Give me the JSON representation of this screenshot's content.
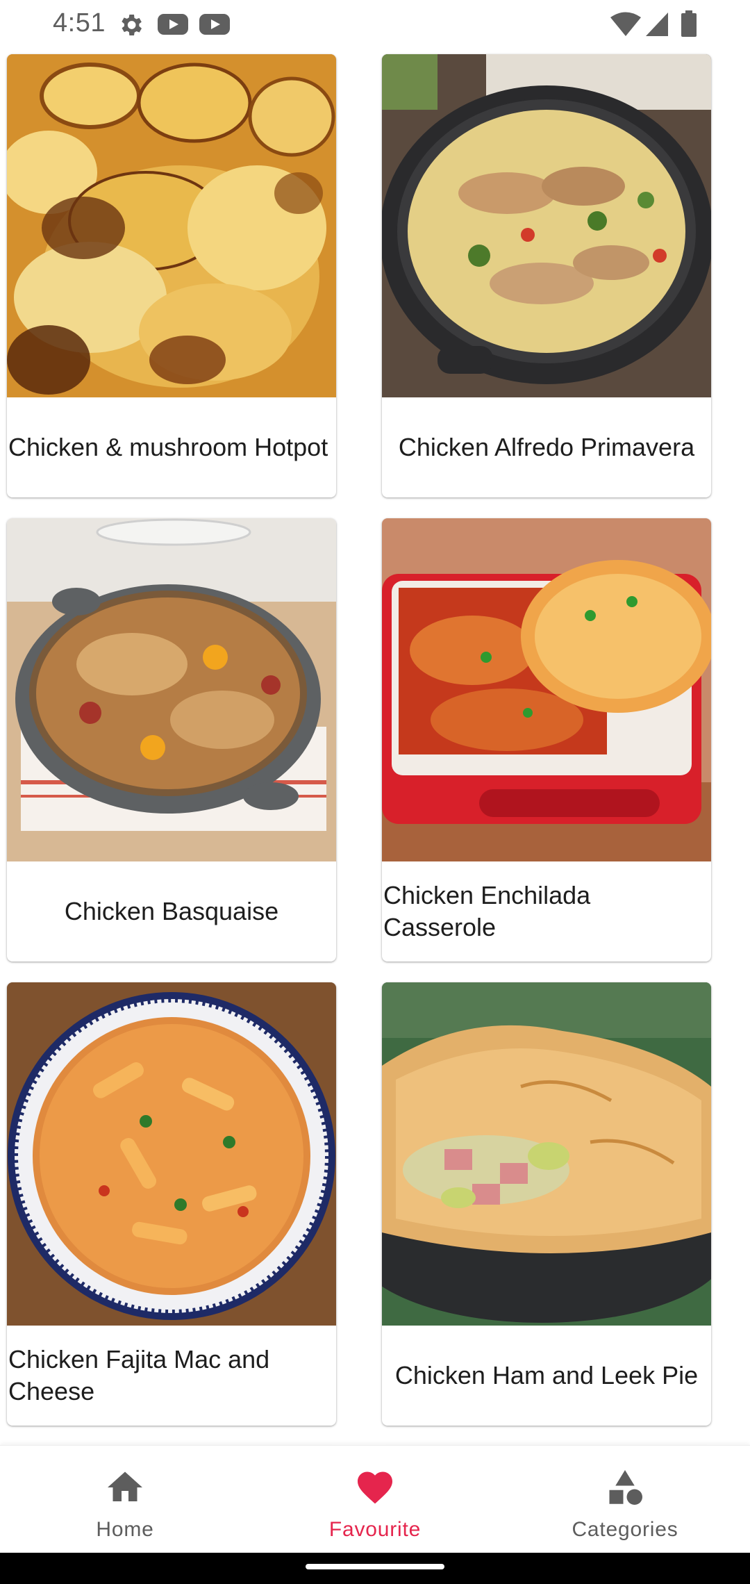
{
  "status_bar": {
    "time": "4:51",
    "icons_left": [
      "gear-icon",
      "youtube-icon",
      "youtube-icon"
    ],
    "icons_right": [
      "wifi-icon",
      "cell-signal-icon",
      "battery-icon"
    ]
  },
  "recipes": [
    {
      "title": "Chicken & mushroom Hotpot",
      "image": "potato-hotpot"
    },
    {
      "title": "Chicken Alfredo Primavera",
      "image": "pasta-pan"
    },
    {
      "title": "Chicken Basquaise",
      "image": "chicken-casserole-pan"
    },
    {
      "title": "Chicken Enchilada Casserole",
      "image": "enchilada-red-dish"
    },
    {
      "title": "Chicken Fajita Mac and Cheese",
      "image": "macaroni-bowl"
    },
    {
      "title": "Chicken Ham and Leek Pie",
      "image": "pastry-pie"
    }
  ],
  "bottom_nav": {
    "items": [
      {
        "label": "Home",
        "icon": "home-icon",
        "active": false
      },
      {
        "label": "Favourite",
        "icon": "heart-icon",
        "active": true
      },
      {
        "label": "Categories",
        "icon": "categories-icon",
        "active": false
      }
    ]
  },
  "colors": {
    "accent": "#e5254d",
    "nav_inactive": "#5d5d5d",
    "text": "#1d1d1d"
  }
}
